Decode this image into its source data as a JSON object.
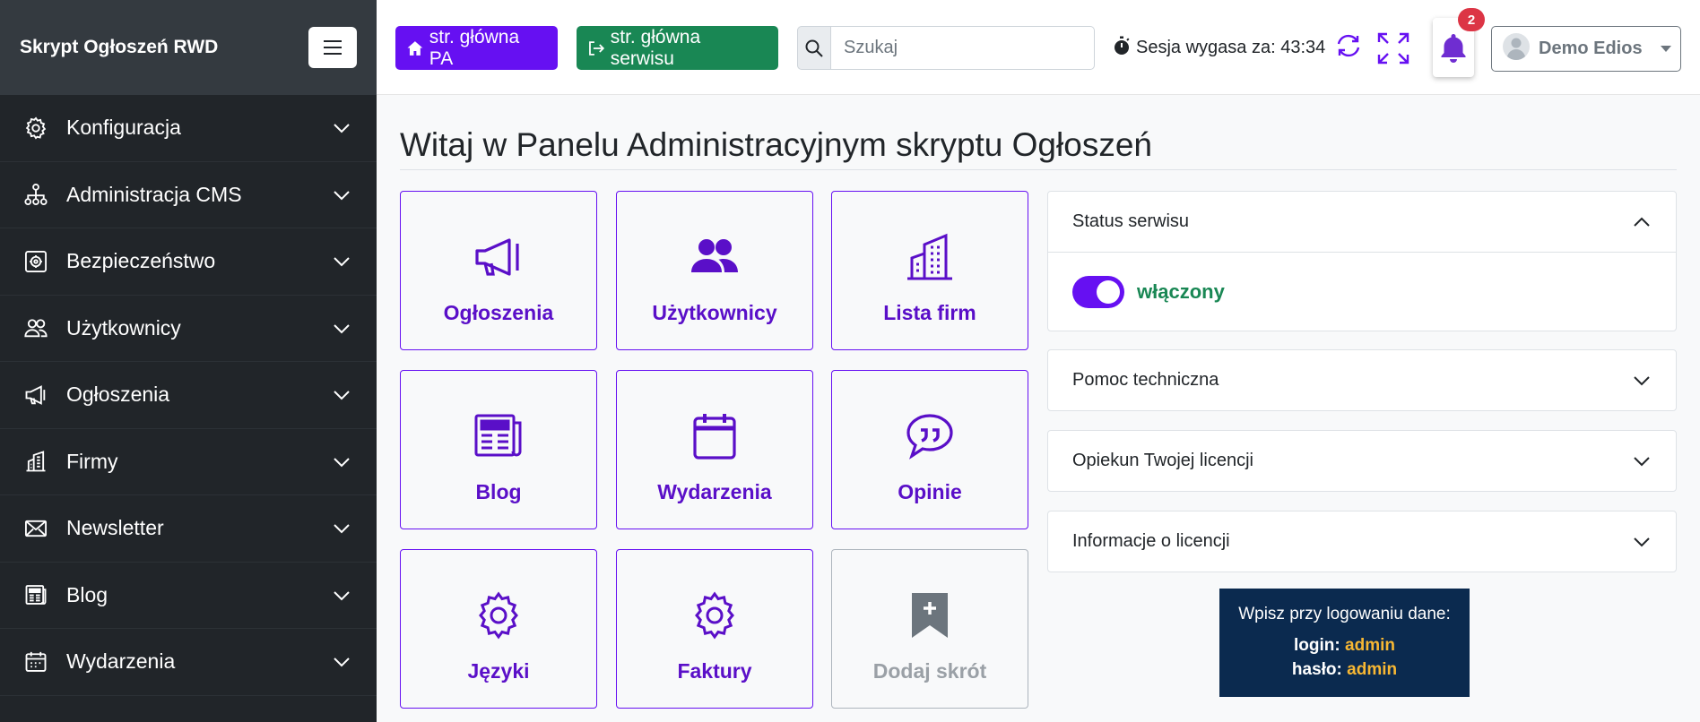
{
  "sidebar": {
    "brand": "Skrypt Ogłoszeń RWD",
    "items": [
      {
        "label": "Konfiguracja",
        "icon": "gear-icon"
      },
      {
        "label": "Administracja CMS",
        "icon": "sitemap-icon"
      },
      {
        "label": "Bezpieczeństwo",
        "icon": "safe-icon"
      },
      {
        "label": "Użytkownicy",
        "icon": "users-icon"
      },
      {
        "label": "Ogłoszenia",
        "icon": "megaphone-icon"
      },
      {
        "label": "Firmy",
        "icon": "buildings-icon"
      },
      {
        "label": "Newsletter",
        "icon": "envelope-icon"
      },
      {
        "label": "Blog",
        "icon": "newspaper-icon"
      },
      {
        "label": "Wydarzenia",
        "icon": "calendar-icon"
      }
    ]
  },
  "topbar": {
    "home_pa": "str. główna PA",
    "home_site": "str. główna serwisu",
    "search_placeholder": "Szukaj",
    "session_label": "Sesja wygasa za: 43:34",
    "notifications_count": "2",
    "user_name": "Demo Edios"
  },
  "main": {
    "title": "Witaj w Panelu Administracyjnym skryptu Ogłoszeń",
    "tiles": [
      {
        "label": "Ogłoszenia",
        "icon": "megaphone-icon"
      },
      {
        "label": "Użytkownicy",
        "icon": "users-icon"
      },
      {
        "label": "Lista firm",
        "icon": "buildings-icon"
      },
      {
        "label": "Blog",
        "icon": "newspaper-icon"
      },
      {
        "label": "Wydarzenia",
        "icon": "calendar-icon"
      },
      {
        "label": "Opinie",
        "icon": "quote-bubble-icon"
      },
      {
        "label": "Języki",
        "icon": "gear-icon"
      },
      {
        "label": "Faktury",
        "icon": "gear-icon"
      },
      {
        "label": "Dodaj skrót",
        "icon": "bookmark-plus-icon"
      }
    ]
  },
  "panels": {
    "status": {
      "title": "Status serwisu",
      "toggle_label": "włączony",
      "enabled": true
    },
    "help": {
      "title": "Pomoc techniczna"
    },
    "keeper": {
      "title": "Opiekun Twojej licencji"
    },
    "license": {
      "title": "Informacje o licencji"
    }
  },
  "login_box": {
    "hint": "Wpisz przy logowaniu dane:",
    "login_label": "login:",
    "login_value": "admin",
    "password_label": "hasło:",
    "password_value": "admin"
  },
  "colors": {
    "accent": "#6610f2",
    "success": "#198754",
    "sidebar_bg": "#212529",
    "danger": "#dc3545"
  }
}
